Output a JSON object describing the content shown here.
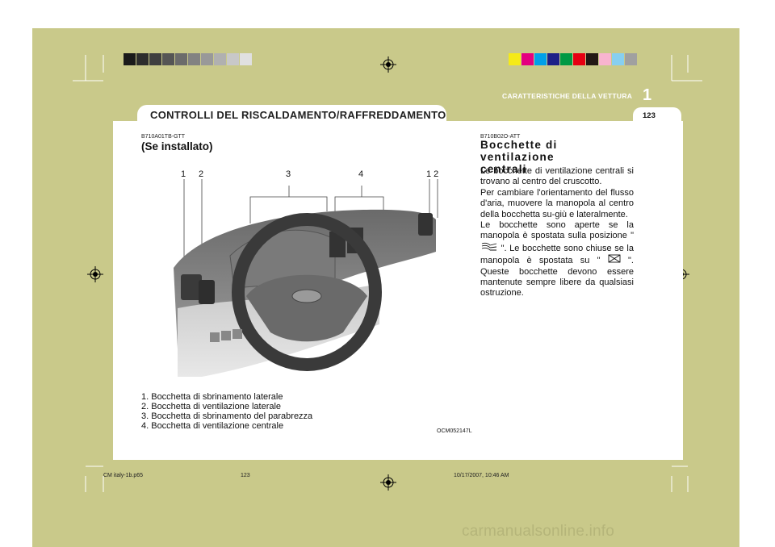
{
  "header": {
    "section_label": "CARATTERISTICHE DELLA VETTURA",
    "chapter_number": "1",
    "page_number": "123",
    "title": "CONTROLLI DEL RISCALDAMENTO/RAFFREDDAMENTO"
  },
  "left": {
    "code": "B710A01TB-GTT",
    "heading": "(Se installato)",
    "callouts": [
      "1",
      "2",
      "3",
      "4",
      "1 2"
    ],
    "legend": [
      "1. Bocchetta di sbrinamento laterale",
      "2. Bocchetta di ventilazione laterale",
      "3. Bocchetta di sbrinamento del parabrezza",
      "4. Bocchetta di ventilazione centrale"
    ],
    "image_code": "OCM052147L"
  },
  "right": {
    "code": "B710B02O-ATT",
    "heading_line1": "Bocchette di ventilazione",
    "heading_line2": "centrali",
    "paragraph": [
      "Le bocchette di ventilazione centrali si trovano al centro del cruscotto.",
      "Per cambiare l'orientamento del flusso d'aria, muovere la manopola al centro della bocchetta su-giù e lateralmente.",
      "Le bocchette sono aperte se la manopola è spostata sulla posizione \"",
      "\". Le bocchette sono chiuse se la manopola è spostata su \"",
      "\". Queste bocchette devono essere mantenute sempre libere da qualsiasi ostruzione."
    ]
  },
  "footer": {
    "file": "CM italy-1b.p65",
    "page": "123",
    "timestamp": "10/17/2007, 10:46 AM"
  },
  "watermark": "carmanualsonline.info",
  "colors": {
    "olive": "#c9c98a",
    "grays": [
      "#1a1a1a",
      "#2d2d2d",
      "#3f3f3f",
      "#555555",
      "#6b6b6b",
      "#828282",
      "#999999",
      "#b0b0b0",
      "#c8c8c8",
      "#e0e0e0"
    ],
    "process": [
      "#f5ea18",
      "#e4007f",
      "#00a0e9",
      "#1d2088",
      "#009944",
      "#e60012",
      "#231815",
      "#f8b4cf",
      "#87cff0",
      "#a0a0a0"
    ]
  }
}
